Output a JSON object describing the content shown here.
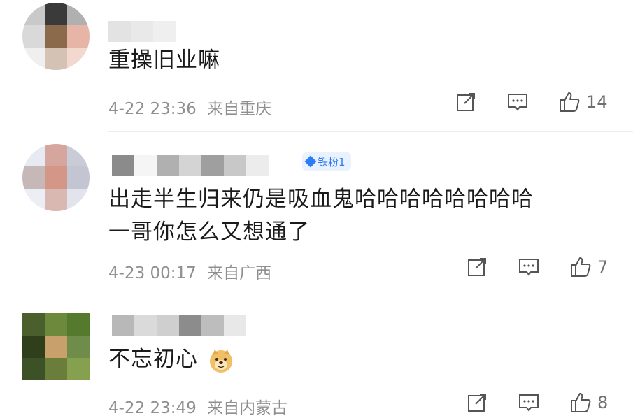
{
  "comments": [
    {
      "text_lines": [
        "重操旧业嘛"
      ],
      "timestamp": "4-22 23:36",
      "location": "来自重庆",
      "like_count": "14",
      "badge": null,
      "avatar_colors": [
        "#c9c9c9",
        "#3a3a3a",
        "#b0b0b0",
        "#d9d9d9",
        "#8a6a4a",
        "#e6b5a8",
        "#efefef",
        "#d4c3b4",
        "#f3d8d0"
      ],
      "name_colors": [
        "#e3e3e3",
        "#e9e9e9",
        "#efefef"
      ]
    },
    {
      "text_lines": [
        "出走半生归来仍是吸血鬼哈哈哈哈哈哈哈哈",
        "一哥你怎么又想通了"
      ],
      "timestamp": "4-23 00:17",
      "location": "来自广西",
      "like_count": "7",
      "badge": "铁粉1",
      "avatar_colors": [
        "#e7eaf2",
        "#d6a59d",
        "#c9ccd6",
        "#c7b8b8",
        "#d49686",
        "#c3c6d2",
        "#eceef4",
        "#d8b8b0",
        "#e2e4ec"
      ],
      "name_colors": [
        "#8b8b8b",
        "#f5f5f5",
        "#b0b0b0",
        "#d4d4d4",
        "#9f9f9f",
        "#c8c8c8",
        "#ececec"
      ]
    },
    {
      "text_lines": [
        "不忘初心"
      ],
      "timestamp": "4-22 23:49",
      "location": "来自内蒙古",
      "like_count": "8",
      "badge": null,
      "avatar_colors": [
        "#4a5f2c",
        "#6d8a3c",
        "#557a2e",
        "#2f3f1c",
        "#c7a06c",
        "#6f8c4a",
        "#3c5226",
        "#6a7d3a",
        "#85a04e"
      ],
      "name_colors": [
        "#b8b8b8",
        "#dadada",
        "#cfcfcf",
        "#8c8c8c",
        "#bdbdbd",
        "#e8e8e8"
      ]
    }
  ],
  "icons": {
    "share": "share-icon",
    "comment": "comment-icon",
    "like": "thumbs-up-icon",
    "emoji": "doge-emoji-icon",
    "badge": "fan-diamond-icon"
  },
  "colors": {
    "text": "#1a1a1a",
    "meta": "#8f8f8f",
    "badge": "#2d7df6"
  }
}
